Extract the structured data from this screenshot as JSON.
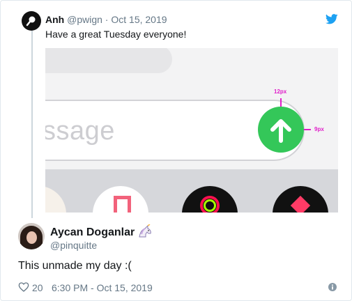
{
  "quoted": {
    "name": "Anh",
    "handle": "@pwign",
    "separator": " · ",
    "date": "Oct 15, 2019",
    "text": "Have a great Tuesday everyone!",
    "media": {
      "message_placeholder": "ssage",
      "spacing_top_label": "12px",
      "spacing_right_label": "9px"
    }
  },
  "tweet": {
    "author_name": "Aycan Doganlar",
    "author_emoji": "unicorn",
    "handle": "@pinquitte",
    "text": "This unmade my day :(",
    "like_count": "20",
    "timestamp": "6:30 PM - Oct 15, 2019"
  },
  "colors": {
    "brand": "#1da1f2",
    "send_button": "#34c759",
    "guide_magenta": "#e01ec9",
    "secondary_text": "#657786"
  },
  "icons": [
    "twitter-bird-icon",
    "like-heart-icon",
    "info-icon",
    "unicorn-emoji",
    "send-arrow-icon"
  ]
}
